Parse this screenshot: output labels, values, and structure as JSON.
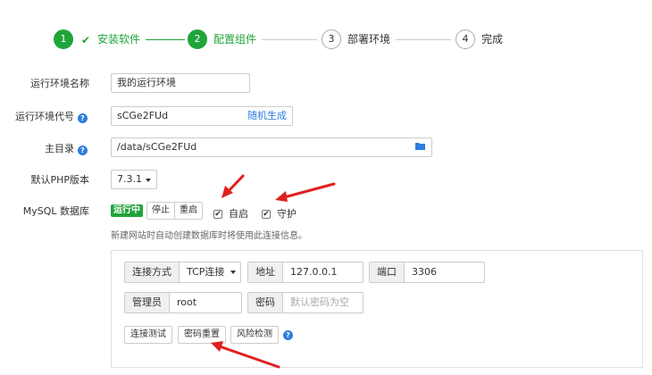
{
  "stepper": {
    "steps": [
      {
        "num": "1",
        "label": "安装软件",
        "state": "done"
      },
      {
        "num": "2",
        "label": "配置组件",
        "state": "active"
      },
      {
        "num": "3",
        "label": "部署环境",
        "state": "todo"
      },
      {
        "num": "4",
        "label": "完成",
        "state": "todo"
      }
    ]
  },
  "form": {
    "env_name": {
      "label": "运行环境名称",
      "value": "我的运行环境"
    },
    "env_code": {
      "label": "运行环境代号",
      "value": "sCGe2FUd",
      "generate": "随机生成"
    },
    "home_dir": {
      "label": "主目录",
      "value": "/data/sCGe2FUd"
    },
    "php_version": {
      "label": "默认PHP版本",
      "value": "7.3.1"
    },
    "mysql": {
      "label": "MySQL 数据库",
      "status": "运行中",
      "stop": "停止",
      "restart": "重启",
      "autostart": "自启",
      "guard": "守护",
      "info": "新建网站时自动创建数据库时将使用此连接信息。"
    }
  },
  "connection": {
    "method_label": "连接方式",
    "method_value": "TCP连接",
    "address_label": "地址",
    "address_value": "127.0.0.1",
    "port_label": "端口",
    "port_value": "3306",
    "admin_label": "管理员",
    "admin_value": "root",
    "password_label": "密码",
    "password_placeholder": "默认密码为空",
    "test_button": "连接测试",
    "reset_button": "密码重置",
    "risk_button": "风险检测"
  },
  "colors": {
    "accent": "#20a53a",
    "link": "#2d7ce0",
    "annotation": "#e02020"
  },
  "icons": {
    "check": "check-icon",
    "help": "help-icon",
    "folder": "folder-icon",
    "dropdown": "chevron-down-icon"
  }
}
